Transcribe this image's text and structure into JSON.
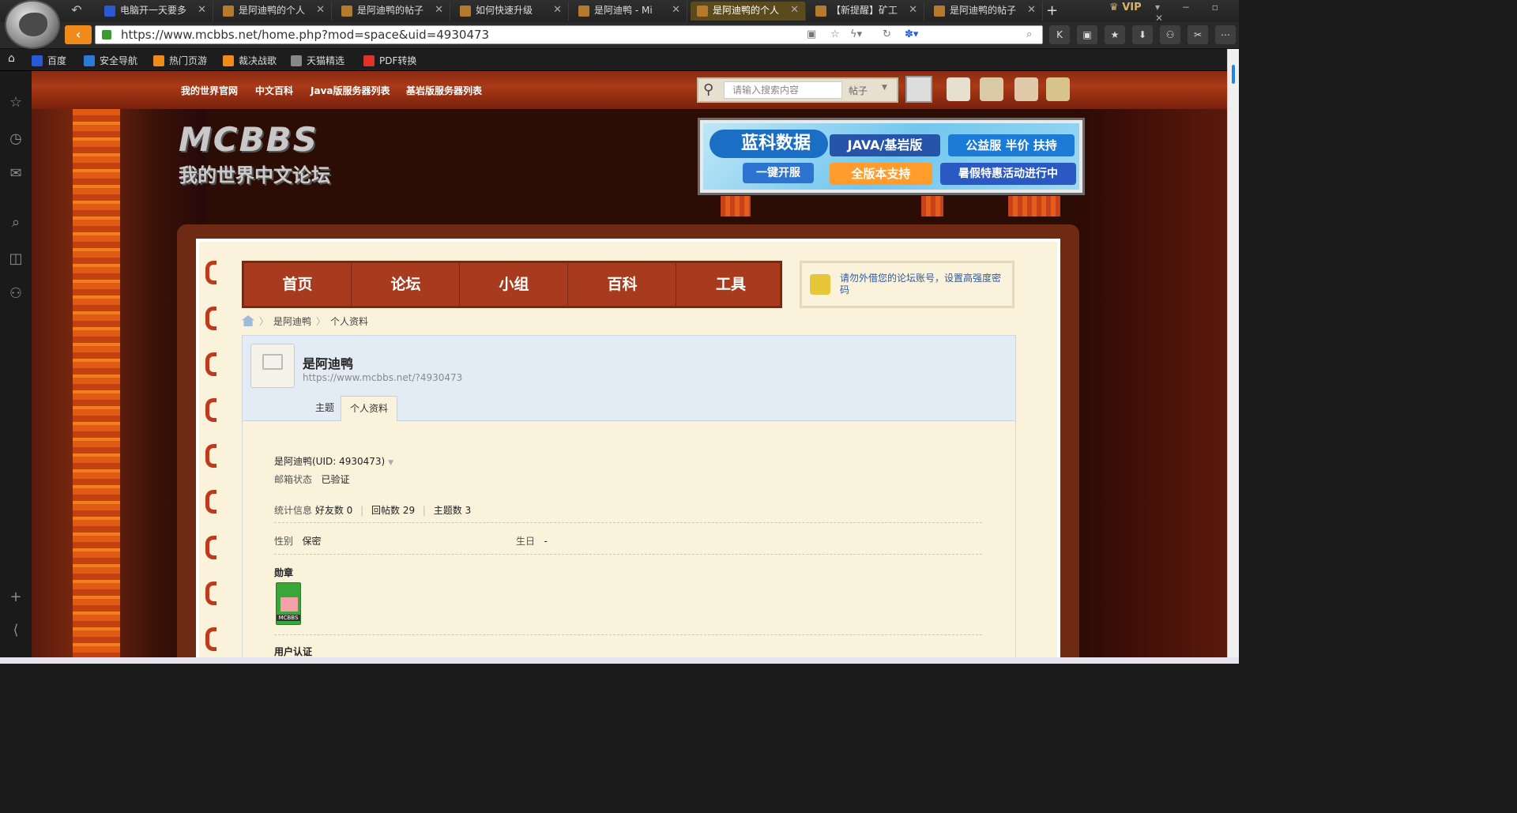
{
  "browser": {
    "tabs": [
      {
        "title": "电脑开一天要多",
        "icon": "baidu-icon",
        "active": false
      },
      {
        "title": "是阿迪鸭的个人",
        "icon": "mcbbs-icon",
        "active": false
      },
      {
        "title": "是阿迪鸭的帖子",
        "icon": "mcbbs-icon",
        "active": false
      },
      {
        "title": "如何快速升级",
        "icon": "mcbbs-icon",
        "active": false
      },
      {
        "title": "是阿迪鸭 - Mi",
        "icon": "mcbbs-icon",
        "active": false
      },
      {
        "title": "是阿迪鸭的个人",
        "icon": "mcbbs-icon",
        "active": true
      },
      {
        "title": "【新提醒】矿工",
        "icon": "mcbbs-icon",
        "active": false
      },
      {
        "title": "是阿迪鸭的帖子",
        "icon": "mcbbs-icon",
        "active": false
      }
    ],
    "new_tab": "+",
    "vip": "VIP",
    "url": "https://www.mcbbs.net/home.php?mod=space&uid=4930473",
    "bookmarks": [
      "百度",
      "安全导航",
      "热门页游",
      "裁决战歌",
      "天猫精选",
      "PDF转换"
    ]
  },
  "site": {
    "top_links": [
      "我的世界官网",
      "中文百科",
      "Java版服务器列表",
      "基岩版服务器列表"
    ],
    "search_placeholder": "请输入搜索内容",
    "search_type": "帖子",
    "logo_big": "MCBBS",
    "logo_small": "我的世界中文论坛",
    "ad": {
      "brand": "蓝科数据",
      "edition": "JAVA/基岩版",
      "promo": "公益服 半价 扶持",
      "open": "一键开服",
      "support": "全版本支持",
      "event": "暑假特惠活动进行中"
    },
    "main_nav": [
      "首页",
      "论坛",
      "小组",
      "百科",
      "工具"
    ],
    "notice": "请勿外借您的论坛账号，设置高强度密码"
  },
  "profile": {
    "breadcrumb": [
      "是阿迪鸭",
      "个人资料"
    ],
    "name": "是阿迪鸭",
    "url": "https://www.mcbbs.net/?4930473",
    "tabs": [
      "主题",
      "个人资料"
    ],
    "active_tab": "个人资料",
    "uid_line": "是阿迪鸭(UID: 4930473)",
    "email_label": "邮箱状态",
    "email_value": "已验证",
    "stats_label": "统计信息",
    "friends": "好友数 0",
    "replies": "回帖数 29",
    "threads": "主题数 3",
    "gender_label": "性别",
    "gender_value": "保密",
    "birthday_label": "生日",
    "birthday_value": "-",
    "medals_label": "勋章",
    "medal_text": "MCBBS",
    "verify_label": "用户认证"
  }
}
